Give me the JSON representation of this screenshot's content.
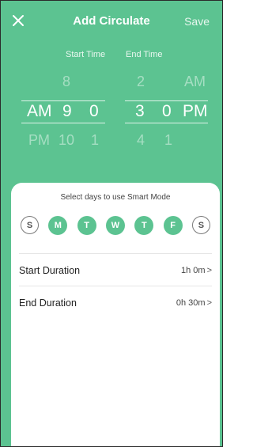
{
  "header": {
    "title": "Add Circulate",
    "save_label": "Save"
  },
  "picker": {
    "start_label": "Start Time",
    "end_label": "End Time",
    "start": {
      "ampm": [
        "AM",
        "PM"
      ],
      "hours": [
        "8",
        "9",
        "10"
      ],
      "minutes": [
        "0",
        "1"
      ]
    },
    "end": {
      "hours": [
        "2",
        "3",
        "4"
      ],
      "minutes": [
        "0",
        "1"
      ],
      "ampm": [
        "AM",
        "PM"
      ]
    }
  },
  "sheet": {
    "title": "Select days to use Smart Mode",
    "days": [
      {
        "label": "S",
        "active": false
      },
      {
        "label": "M",
        "active": true
      },
      {
        "label": "T",
        "active": true
      },
      {
        "label": "W",
        "active": true
      },
      {
        "label": "T",
        "active": true
      },
      {
        "label": "F",
        "active": true
      },
      {
        "label": "S",
        "active": false
      }
    ],
    "start_duration": {
      "label": "Start Duration",
      "value": "1h 0m"
    },
    "end_duration": {
      "label": "End Duration",
      "value": "0h 30m"
    }
  },
  "colors": {
    "accent": "#5cc391"
  },
  "icons": {
    "close": "close-icon",
    "chevron": "chevron-right-icon"
  }
}
